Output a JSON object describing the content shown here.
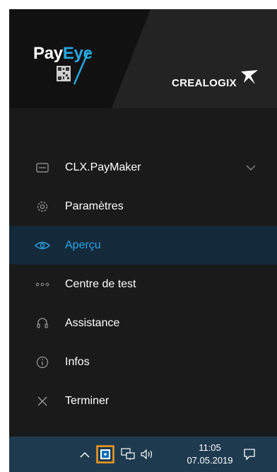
{
  "header": {
    "brand_pay": "Pay",
    "brand_eye": "Eye",
    "partner": "CREALOGIX"
  },
  "menu": {
    "items": [
      {
        "label": "CLX.PayMaker",
        "icon": "card-icon",
        "expandable": true
      },
      {
        "label": "Paramètres",
        "icon": "gear-icon"
      },
      {
        "label": "Aperçu",
        "icon": "eye-icon",
        "active": true
      },
      {
        "label": "Centre de test",
        "icon": "more-dots-icon"
      },
      {
        "label": "Assistance",
        "icon": "headset-icon"
      },
      {
        "label": "Infos",
        "icon": "info-icon"
      },
      {
        "label": "Terminer",
        "icon": "close-icon"
      }
    ]
  },
  "taskbar": {
    "time": "11:05",
    "date": "07.05.2019"
  },
  "colors": {
    "accent": "#2aa6e8",
    "panel_bg": "#1a1a1a",
    "active_bg": "#14293a",
    "taskbar_bg": "#1e3a4f",
    "highlight_border": "#f39a1e"
  }
}
